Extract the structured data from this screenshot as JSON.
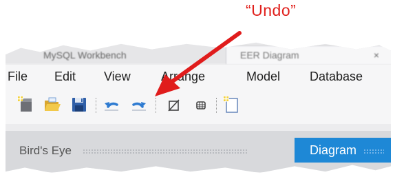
{
  "callout": {
    "label": "“Undo”",
    "color": "#e0201c"
  },
  "window": {
    "tab_inactive_label": "MySQL Workbench",
    "tab_active_label": "EER Diagram",
    "tab_close": "×"
  },
  "menubar": {
    "items": [
      {
        "label": "File"
      },
      {
        "label": "Edit"
      },
      {
        "label": "View"
      },
      {
        "label": "Arrange"
      },
      {
        "label": "Model"
      },
      {
        "label": "Database"
      }
    ]
  },
  "toolbar": {
    "buttons": [
      {
        "icon": "new-model-icon"
      },
      {
        "icon": "open-folder-icon"
      },
      {
        "icon": "save-floppy-icon"
      },
      {
        "icon": "undo-icon"
      },
      {
        "icon": "redo-icon"
      },
      {
        "icon": "toggle-grid-icon"
      },
      {
        "icon": "align-grid-icon"
      },
      {
        "icon": "new-page-icon"
      }
    ]
  },
  "panels": {
    "birds_eye_label": "Bird's Eye",
    "diagram_label": "Diagram",
    "accent_color": "#1e88d6"
  }
}
